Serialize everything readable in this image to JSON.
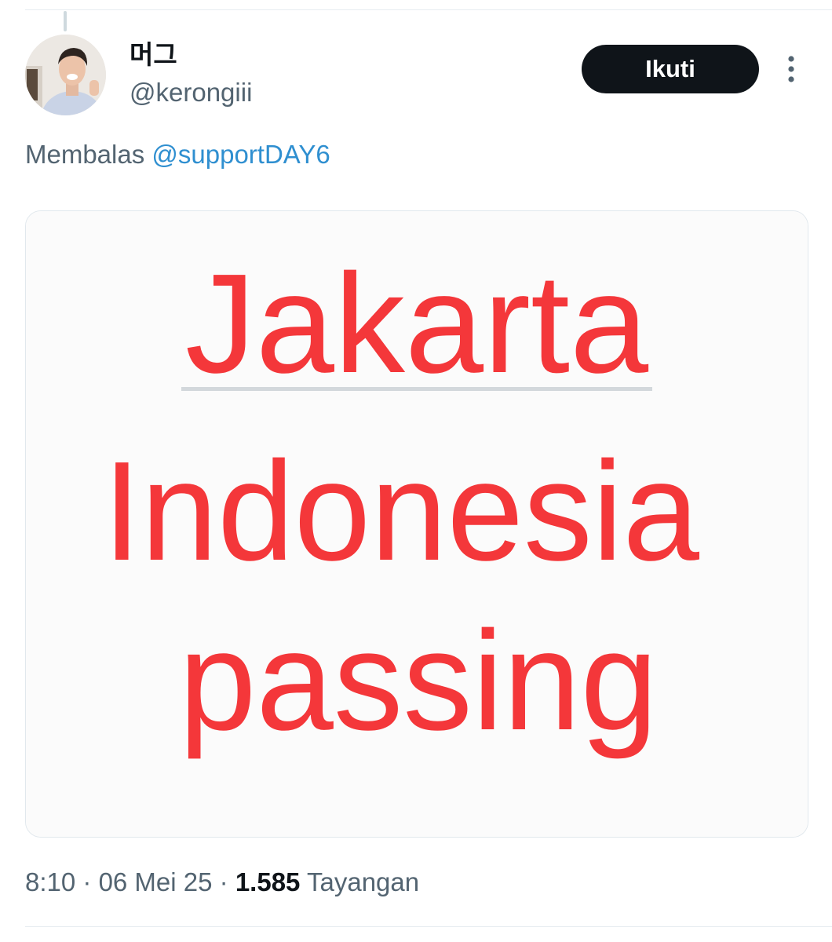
{
  "tweet": {
    "author": {
      "display_name": "머그",
      "handle": "@kerongiii"
    },
    "follow_label": "Ikuti",
    "reply": {
      "prefix": "Membalas ",
      "mention": "@supportDAY6"
    },
    "image": {
      "line1": "Jakarta",
      "line2": "Indonesia",
      "line3": "passing",
      "text_color": "#f4373a"
    },
    "meta": {
      "time": "8:10",
      "separator": " · ",
      "date": "06 Mei 25",
      "views_count": "1.585",
      "views_label": "Tayangan"
    }
  },
  "icons": {
    "more": "more-vertical-icon"
  },
  "colors": {
    "follow_bg": "#0f1419",
    "mention": "#2f8fd0",
    "secondary_text": "#536471"
  }
}
